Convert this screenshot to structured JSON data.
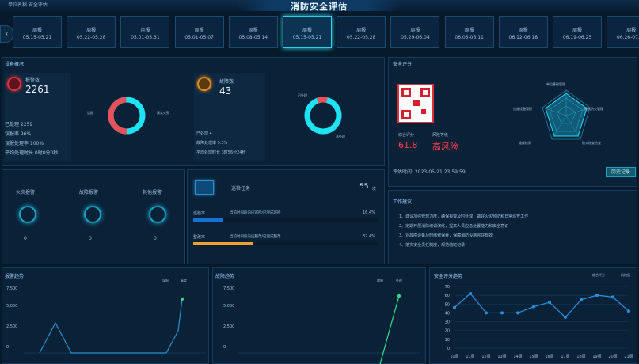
{
  "header": {
    "subtitle": "…单位名称 安全评估",
    "title": "消防安全评估"
  },
  "nav": {
    "back_label": "‹"
  },
  "tabs": [
    {
      "l1": "周报",
      "l2": "05.15-05.21"
    },
    {
      "l1": "周报",
      "l2": "05.22-05.28"
    },
    {
      "l1": "月报",
      "l2": "05.01-05.31"
    },
    {
      "l1": "周报",
      "l2": "05.01-05.07"
    },
    {
      "l1": "周报",
      "l2": "05.08-05.14"
    },
    {
      "l1": "周报",
      "l2": "05.15-05.21"
    },
    {
      "l1": "周报",
      "l2": "05.22-05.28"
    },
    {
      "l1": "周报",
      "l2": "05.29-06.04"
    },
    {
      "l1": "周报",
      "l2": "06.05-06.11"
    },
    {
      "l1": "周报",
      "l2": "06.12-06.18"
    },
    {
      "l1": "周报",
      "l2": "06.19-06.25"
    },
    {
      "l1": "周报",
      "l2": "06.26-07.02"
    }
  ],
  "overview": {
    "title": "设备概况"
  },
  "alarm": {
    "label": "报警数",
    "value": "2261",
    "lines": [
      "已处理 2259",
      "误报率 96%",
      "误报处理率 100%",
      "平均处理时长 0时0分0秒"
    ],
    "legend_left": "误报",
    "legend_right": "真实火警"
  },
  "fault": {
    "label": "故障数",
    "value": "43",
    "lines": [
      "已处理 4",
      "故障处理率 9.3%",
      "平均处理时长 3时56分24秒"
    ],
    "legend_top": "已处理",
    "legend_bottom": "未处理"
  },
  "safety": {
    "title": "安全评分",
    "qr_label": "扫码查看",
    "score_label": "综合评分",
    "score": "61.8",
    "level_label": "风险等级",
    "level": "高风险",
    "time": "评估时间: 2023-05-21 23:59:59",
    "btn": "历史记录"
  },
  "radar": {
    "labels": [
      "单位基础管理",
      "建筑防火管理",
      "防火巡查检查",
      "维保检测",
      "设施设备管理"
    ]
  },
  "stats": [
    {
      "label": "火灾报警",
      "value": "0"
    },
    {
      "label": "故障报警",
      "value": "0"
    },
    {
      "label": "其他报警",
      "value": "0"
    }
  ],
  "inspection": {
    "label": "巡检任务",
    "value": "55",
    "unit": "次",
    "rows": [
      {
        "name": "巡检率",
        "desc": "当前时间段内应巡检/已完成巡检",
        "pct": "16.4%",
        "fill": 0.164,
        "color": "#1b6fd6"
      },
      {
        "name": "整改率",
        "desc": "当前时间段内应整改/已完成整改",
        "pct": "32.4%",
        "fill": 0.324,
        "color": "#f0a030"
      }
    ]
  },
  "work": {
    "title": "工作建议",
    "items": [
      "1、建议加强管理力度，确保报警及时处理，做好火灾预防和日常巡查工作",
      "2、定期开展消防培训演练，提高人员应急处置能力和安全意识",
      "3、对故障设备及时维修保养，保障消防设施完好有效",
      "4、落实安全责任制度，规范值班记录"
    ]
  },
  "chart1": {
    "title": "报警趋势",
    "legend": [
      "误报",
      "真实"
    ],
    "yticks": [
      "7,500",
      "5,000",
      "2,500",
      "0"
    ]
  },
  "chart2": {
    "title": "故障趋势",
    "legend": [
      "故障",
      "处理"
    ],
    "yticks": [
      "7,500",
      "5,000",
      "2,500",
      "0"
    ]
  },
  "chart_data": {
    "type": "line",
    "title": "安全评分趋势",
    "legend": [
      "综合评分",
      "风险值"
    ],
    "categories": [
      "10周",
      "11周",
      "12周",
      "13周",
      "14周",
      "15周",
      "16周",
      "17周",
      "18周",
      "19周",
      "20周",
      "21周"
    ],
    "yticks": [
      "70",
      "60",
      "50",
      "40",
      "30",
      "20",
      "10",
      "0"
    ],
    "ylim": [
      0,
      70
    ],
    "values": [
      46,
      62,
      40,
      40,
      40,
      47,
      52,
      35,
      55,
      60,
      58,
      42
    ]
  }
}
